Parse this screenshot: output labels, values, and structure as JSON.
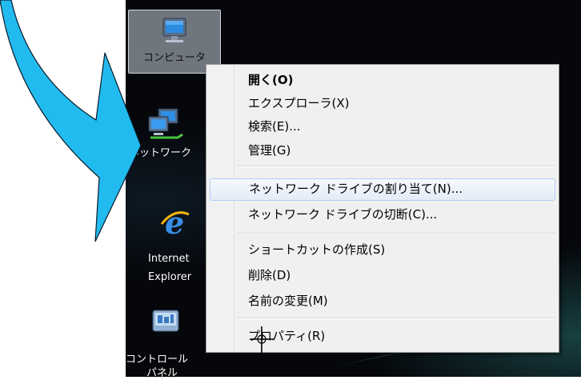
{
  "desktop_icons": [
    {
      "id": "computer",
      "label": "コンピュータ",
      "icon": "computer-icon",
      "selected": true
    },
    {
      "id": "network",
      "label": "ネットワーク",
      "icon": "network-icon",
      "selected": false
    },
    {
      "id": "ie",
      "label_line1": "Internet",
      "label_line2": "Explorer",
      "icon": "internet-explorer-icon",
      "selected": false
    },
    {
      "id": "control-panel",
      "label_line1": "コントロール",
      "label_line2": "パネル",
      "icon": "control-panel-icon",
      "selected": false
    }
  ],
  "context_menu": {
    "items": [
      {
        "label": "開く(O)",
        "bold": true
      },
      {
        "label": "エクスプローラ(X)"
      },
      {
        "label": "検索(E)..."
      },
      {
        "label": "管理(G)"
      },
      {
        "label": "ネットワーク ドライブの割り当て(N)...",
        "highlighted": true
      },
      {
        "label": "ネットワーク ドライブの切断(C)..."
      },
      {
        "label": "ショートカットの作成(S)"
      },
      {
        "label": "削除(D)"
      },
      {
        "label": "名前の変更(M)"
      },
      {
        "label": "プロパティ(R)"
      }
    ]
  },
  "colors": {
    "arrow_fill": "#22bbf0",
    "menu_hover": "#e3ecf7",
    "desktop_bg": "#05070b"
  }
}
